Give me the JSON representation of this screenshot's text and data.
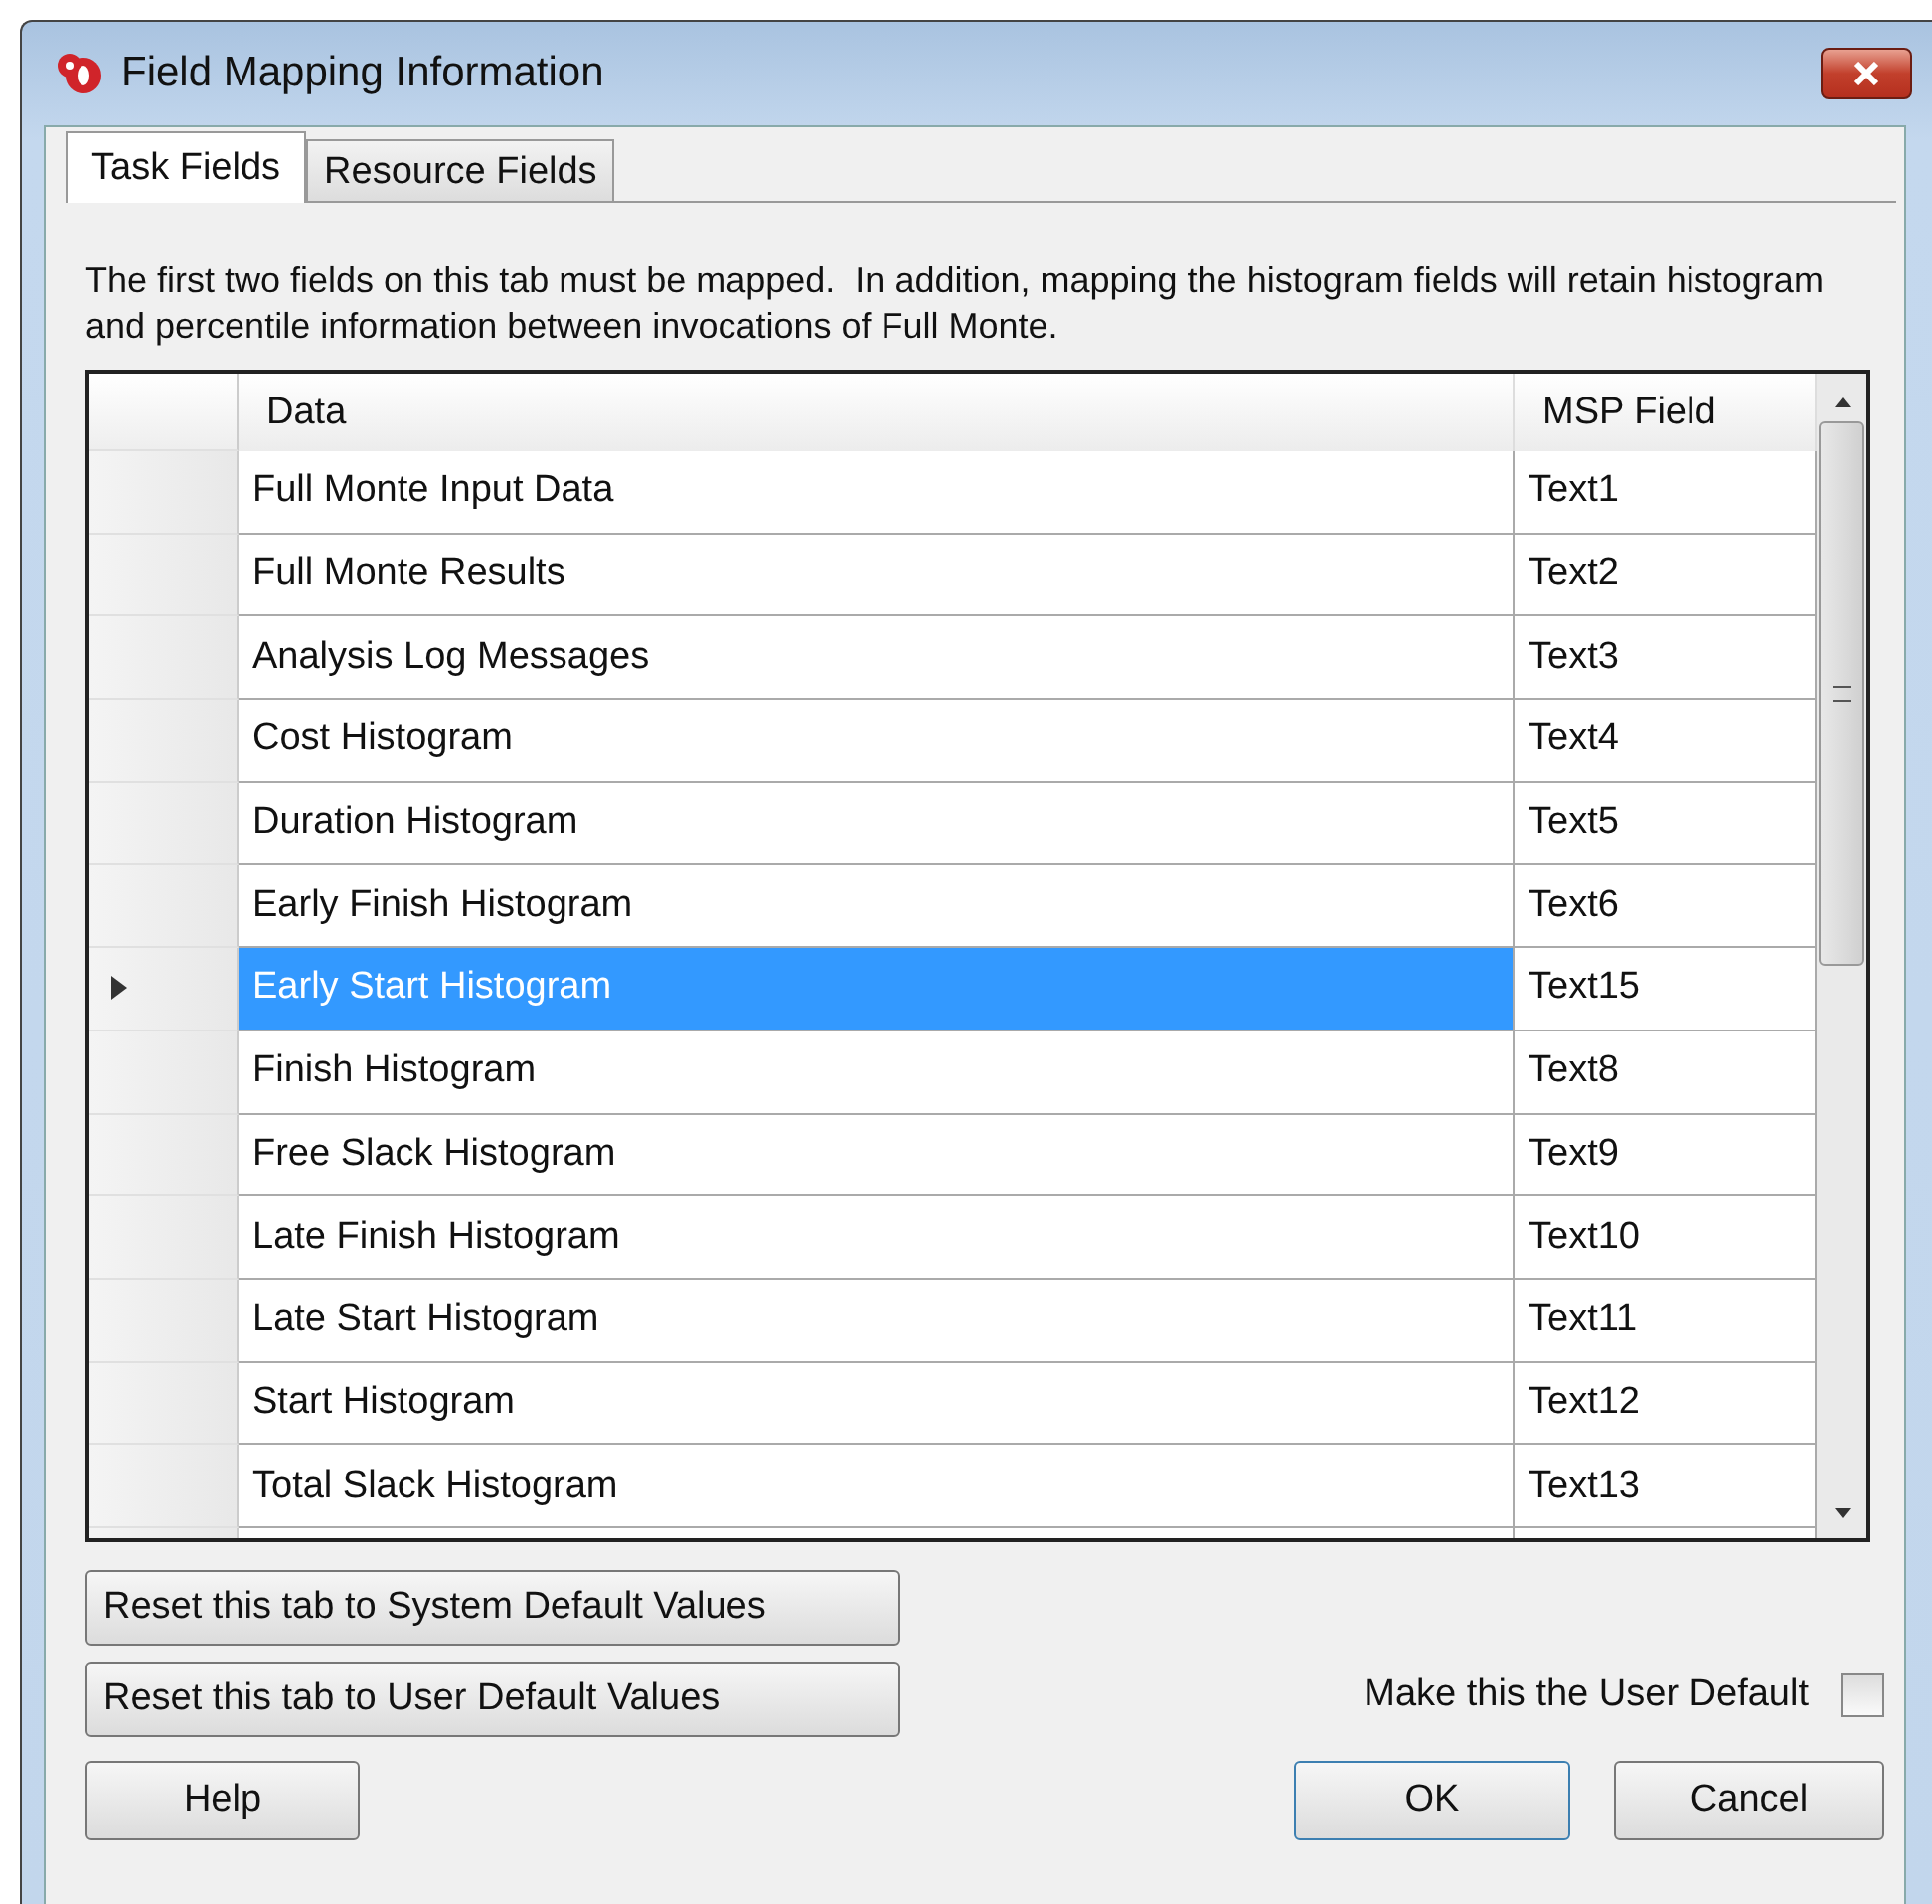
{
  "window": {
    "title": "Field Mapping Information"
  },
  "tabs": [
    {
      "label": "Task Fields",
      "selected": true
    },
    {
      "label": "Resource Fields",
      "selected": false
    }
  ],
  "description": "The first two fields on this tab must be mapped.  In addition, mapping the histogram fields will retain histogram and percentile information between invocations of Full Monte.",
  "table": {
    "columns": [
      "Data",
      "MSP Field"
    ],
    "rows": [
      {
        "data": "Full Monte Input Data",
        "msp_field": "Text1",
        "selected": false
      },
      {
        "data": "Full Monte Results",
        "msp_field": "Text2",
        "selected": false
      },
      {
        "data": "Analysis Log Messages",
        "msp_field": "Text3",
        "selected": false
      },
      {
        "data": "Cost Histogram",
        "msp_field": "Text4",
        "selected": false
      },
      {
        "data": "Duration Histogram",
        "msp_field": "Text5",
        "selected": false
      },
      {
        "data": "Early Finish Histogram",
        "msp_field": "Text6",
        "selected": false
      },
      {
        "data": "Early Start Histogram",
        "msp_field": "Text15",
        "selected": true
      },
      {
        "data": "Finish Histogram",
        "msp_field": "Text8",
        "selected": false
      },
      {
        "data": "Free Slack Histogram",
        "msp_field": "Text9",
        "selected": false
      },
      {
        "data": "Late Finish Histogram",
        "msp_field": "Text10",
        "selected": false
      },
      {
        "data": "Late Start Histogram",
        "msp_field": "Text11",
        "selected": false
      },
      {
        "data": "Start Histogram",
        "msp_field": "Text12",
        "selected": false
      },
      {
        "data": "Total Slack Histogram",
        "msp_field": "Text13",
        "selected": false
      }
    ]
  },
  "reset_buttons": [
    "Reset this tab to System Default Values",
    "Reset this tab to User Default Values"
  ],
  "user_default": {
    "label": "Make this the User Default",
    "checked": false
  },
  "buttons": {
    "help": "Help",
    "ok": "OK",
    "cancel": "Cancel"
  }
}
